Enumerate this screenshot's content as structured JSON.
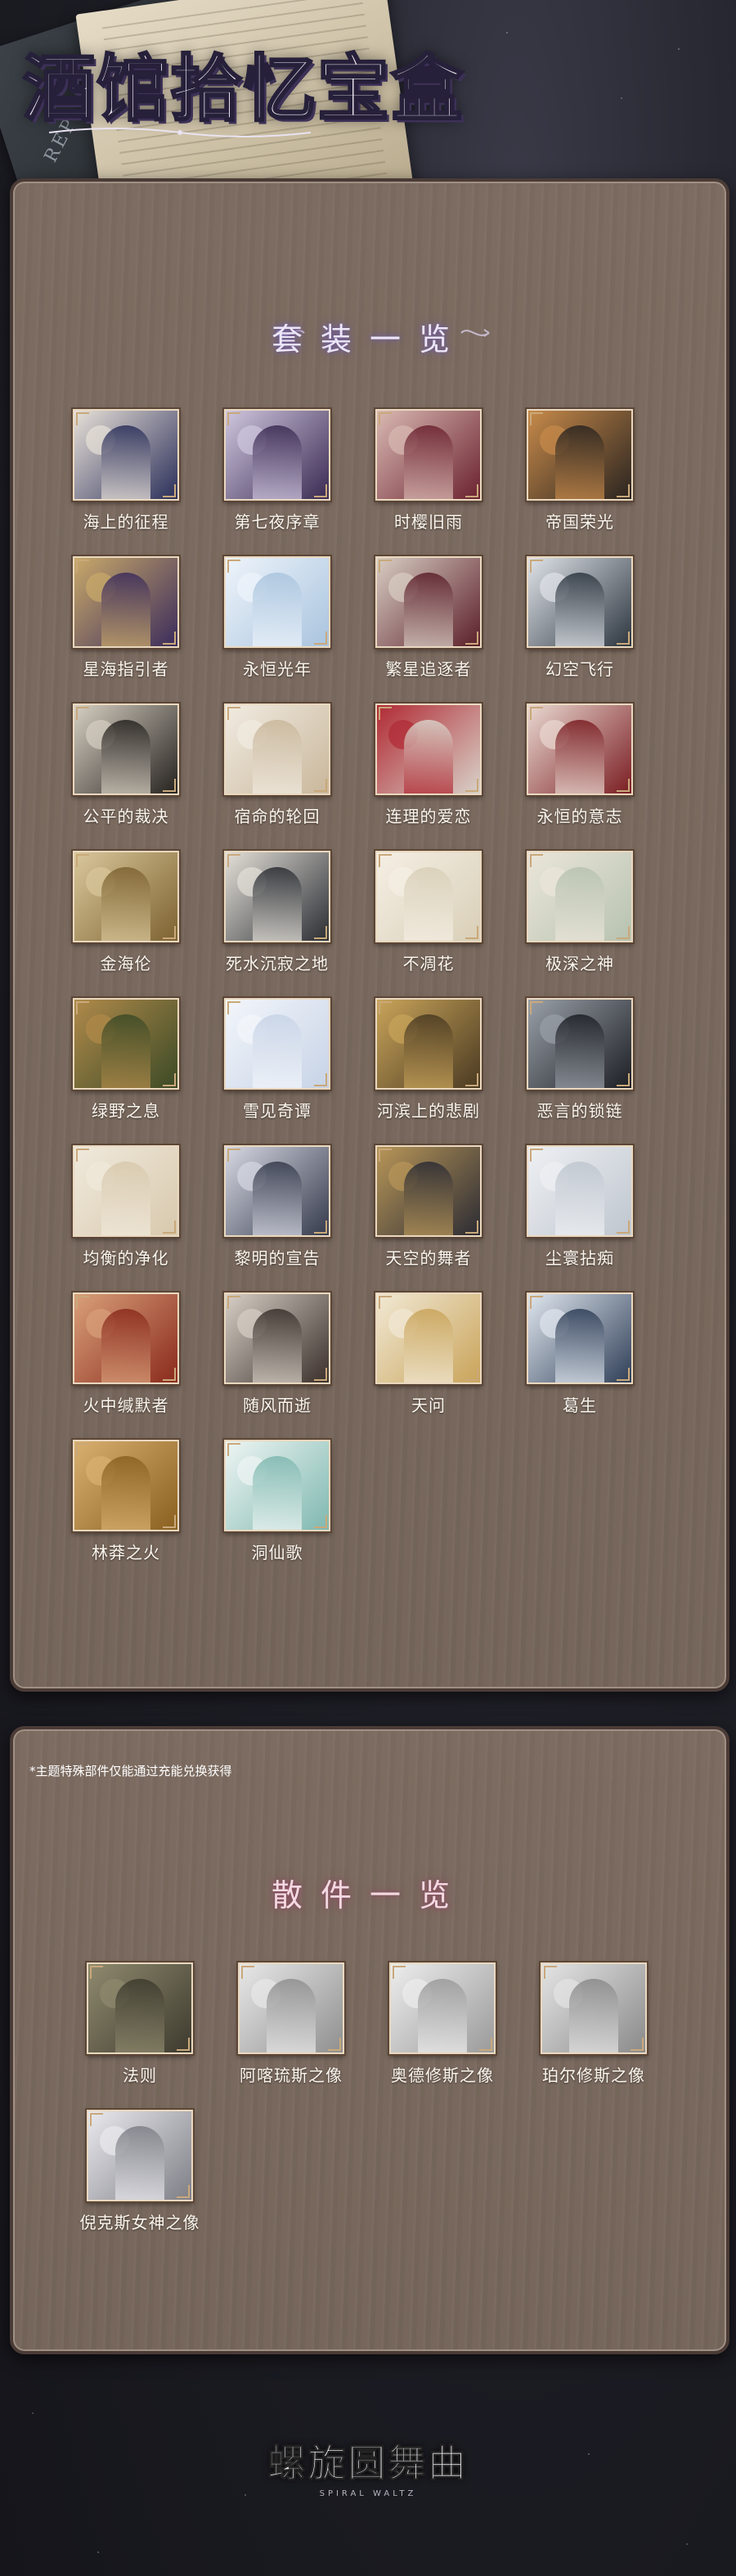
{
  "page": {
    "title": "酒馆拾忆宝盒"
  },
  "book": {
    "spine_text": "REPL"
  },
  "sets": {
    "title": "套装一览",
    "items": [
      {
        "label": "海上的征程",
        "colors": [
          "#2b2f5a",
          "#e8e1d8"
        ]
      },
      {
        "label": "第七夜序章",
        "colors": [
          "#3a2a52",
          "#cfc6de"
        ]
      },
      {
        "label": "时樱旧雨",
        "colors": [
          "#6b2230",
          "#d9b9b2"
        ]
      },
      {
        "label": "帝国荣光",
        "colors": [
          "#2a2420",
          "#c78a4a"
        ]
      },
      {
        "label": "星海指引者",
        "colors": [
          "#3b2c5c",
          "#c9a96a"
        ]
      },
      {
        "label": "永恒光年",
        "colors": [
          "#a9c4de",
          "#eef4fb"
        ]
      },
      {
        "label": "繁星追逐者",
        "colors": [
          "#5b1f2a",
          "#d8cdc3"
        ]
      },
      {
        "label": "幻空飞行",
        "colors": [
          "#2d3640",
          "#dfe3e8"
        ]
      },
      {
        "label": "公平的裁决",
        "colors": [
          "#26221f",
          "#d6cfc2"
        ]
      },
      {
        "label": "宿命的轮回",
        "colors": [
          "#c9b79b",
          "#f1ebe1"
        ]
      },
      {
        "label": "连理的爱恋",
        "colors": [
          "#d8d2c8",
          "#b12a34"
        ]
      },
      {
        "label": "永恒的意志",
        "colors": [
          "#7a1d22",
          "#e9d8d0"
        ]
      },
      {
        "label": "金海伦",
        "colors": [
          "#7d6230",
          "#d9c79b"
        ]
      },
      {
        "label": "死水沉寂之地",
        "colors": [
          "#2a2d33",
          "#e4e0d8"
        ]
      },
      {
        "label": "不凋花",
        "colors": [
          "#d9cfb8",
          "#f5efe4"
        ]
      },
      {
        "label": "极深之神",
        "colors": [
          "#b7c2b0",
          "#ebe6da"
        ]
      },
      {
        "label": "绿野之息",
        "colors": [
          "#3c4a26",
          "#b08a4a"
        ]
      },
      {
        "label": "雪见奇谭",
        "colors": [
          "#c7d3e6",
          "#f3f6fb"
        ]
      },
      {
        "label": "河滨上的悲剧",
        "colors": [
          "#4a3a22",
          "#c9a45a"
        ]
      },
      {
        "label": "恶言的锁链",
        "colors": [
          "#1c1f24",
          "#9aa0a8"
        ]
      },
      {
        "label": "均衡的净化",
        "colors": [
          "#d8c9ad",
          "#f0e9dc"
        ]
      },
      {
        "label": "黎明的宣告",
        "colors": [
          "#353a4c",
          "#d6d8e2"
        ]
      },
      {
        "label": "天空的舞者",
        "colors": [
          "#2c2c34",
          "#b89658"
        ]
      },
      {
        "label": "尘寰拈痴",
        "colors": [
          "#bfc6cf",
          "#eef0f3"
        ]
      },
      {
        "label": "火中缄默者",
        "colors": [
          "#8a2a1c",
          "#d9a07a"
        ]
      },
      {
        "label": "随风而逝",
        "colors": [
          "#3a2f2a",
          "#d7cfc6"
        ]
      },
      {
        "label": "天问",
        "colors": [
          "#c9a45a",
          "#f1e8d4"
        ]
      },
      {
        "label": "葛生",
        "colors": [
          "#2f3e57",
          "#dfe6ee"
        ]
      },
      {
        "label": "林莽之火",
        "colors": [
          "#8a6020",
          "#d9b070"
        ]
      },
      {
        "label": "洞仙歌",
        "colors": [
          "#7fb8b0",
          "#eef5f3"
        ]
      }
    ]
  },
  "loose": {
    "note": "*主题特殊部件仅能通过充能兑换获得",
    "title": "散件一览",
    "items": [
      {
        "label": "法则",
        "colors": [
          "#3d3a2e",
          "#8f8a6e"
        ]
      },
      {
        "label": "阿喀琉斯之像",
        "colors": [
          "#8f8f8f",
          "#e8e8e8"
        ]
      },
      {
        "label": "奥德修斯之像",
        "colors": [
          "#9a9a9a",
          "#ededed"
        ]
      },
      {
        "label": "珀尔修斯之像",
        "colors": [
          "#8a8a8a",
          "#e4e4e4"
        ]
      },
      {
        "label": "倪克斯女神之像",
        "colors": [
          "#7e7e86",
          "#e9e9ee"
        ]
      }
    ]
  },
  "footer": {
    "logo": "螺旋圆舞曲",
    "logo_en": "SPIRAL WALTZ"
  }
}
